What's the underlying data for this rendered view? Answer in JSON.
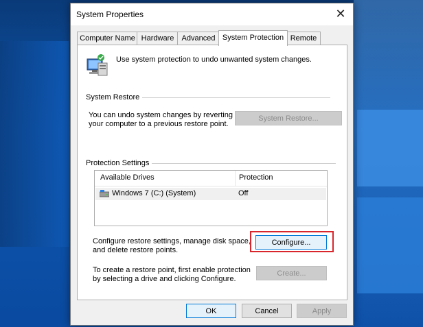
{
  "window": {
    "title": "System Properties",
    "close_label": "✕"
  },
  "tabs": [
    {
      "label": "Computer Name"
    },
    {
      "label": "Hardware"
    },
    {
      "label": "Advanced"
    },
    {
      "label": "System Protection",
      "active": true
    },
    {
      "label": "Remote"
    }
  ],
  "intro_text": "Use system protection to undo unwanted system changes.",
  "system_restore": {
    "title": "System Restore",
    "description_line1": "You can undo system changes by reverting",
    "description_line2": "your computer to a previous restore point.",
    "button_label": "System Restore..."
  },
  "protection_settings": {
    "title": "Protection Settings",
    "columns": [
      "Available Drives",
      "Protection"
    ],
    "drives": [
      {
        "name": "Windows 7 (C:) (System)",
        "protection": "Off"
      }
    ],
    "configure_text_line1": "Configure restore settings, manage disk space,",
    "configure_text_line2": "and delete restore points.",
    "configure_label": "Configure...",
    "create_text_line1": "To create a restore point, first enable protection",
    "create_text_line2": "by selecting a drive and clicking Configure.",
    "create_label": "Create..."
  },
  "footer": {
    "ok_label": "OK",
    "cancel_label": "Cancel",
    "apply_label": "Apply"
  },
  "colors": {
    "highlight": "#d9252c",
    "accent": "#0078d7"
  },
  "icons": {
    "dialog": "system-protection-icon",
    "drive": "hard-drive-icon",
    "close": "close-icon"
  }
}
